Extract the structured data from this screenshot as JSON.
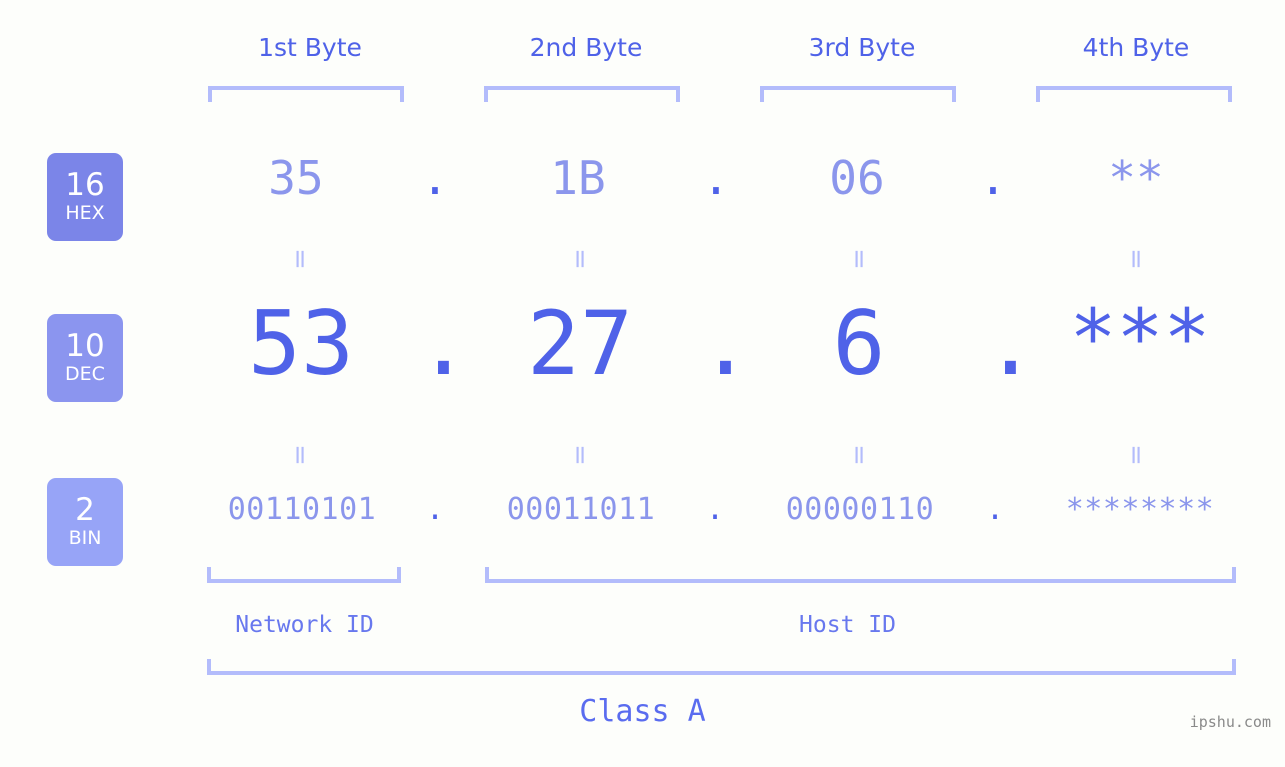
{
  "headers": [
    {
      "label": "1st Byte"
    },
    {
      "label": "2nd Byte"
    },
    {
      "label": "3rd Byte"
    },
    {
      "label": "4th Byte"
    }
  ],
  "radix_badges": [
    {
      "base": "16",
      "name": "HEX",
      "color": "#7b85e8"
    },
    {
      "base": "10",
      "name": "DEC",
      "color": "#8b95ef"
    },
    {
      "base": "2",
      "name": "BIN",
      "color": "#97a4f7"
    }
  ],
  "rows": {
    "hex": {
      "base": "16",
      "name": "HEX",
      "values": [
        "35",
        "1B",
        "06",
        "**"
      ],
      "separators": [
        ".",
        ".",
        "."
      ]
    },
    "dec": {
      "base": "10",
      "name": "DEC",
      "values": [
        "53",
        "27",
        "6",
        "***"
      ],
      "separators": [
        ".",
        ".",
        "."
      ]
    },
    "bin": {
      "base": "2",
      "name": "BIN",
      "values": [
        "00110101",
        "00011011",
        "00000110",
        "********"
      ],
      "separators": [
        ".",
        ".",
        "."
      ]
    }
  },
  "equality_marks": {
    "glyph": "=",
    "between_hex_dec": [
      "=",
      "=",
      "=",
      "="
    ],
    "between_dec_bin": [
      "=",
      "=",
      "=",
      "="
    ]
  },
  "sections": {
    "network_id": "Network ID",
    "host_id": "Host ID"
  },
  "class_label": "Class A",
  "watermark": "ipshu.com",
  "colors": {
    "background": "#fdfefb",
    "accent_strong": "#4f62e8",
    "accent_mid": "#8b96ec",
    "accent_light": "#b3bcfb",
    "badge_hex": "#7b85e8",
    "badge_dec": "#8b95ef",
    "badge_bin": "#97a4f7",
    "watermark": "#8a8a8a"
  }
}
